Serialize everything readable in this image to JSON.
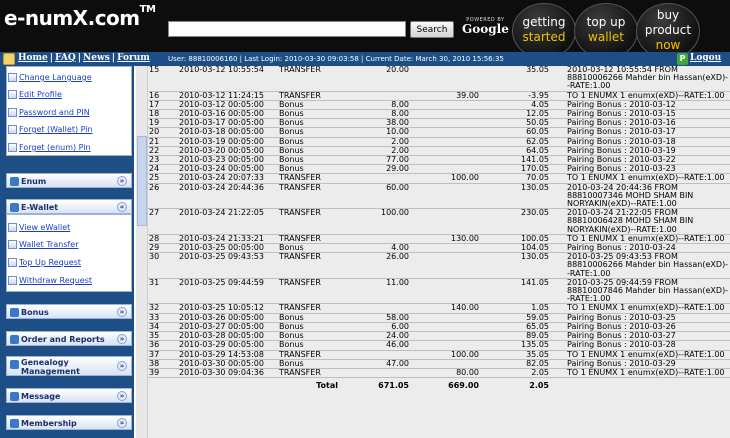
{
  "header": {
    "logo": "e-numX.com",
    "logo_tm": "TM",
    "search_placeholder": "",
    "search_button": "Search",
    "google_powered": "POWERED BY",
    "google_name": "Google",
    "promos": [
      {
        "line1": "getting",
        "line2": "started"
      },
      {
        "line1": "top up",
        "line2": "wallet"
      },
      {
        "line1": "buy",
        "line2": "product",
        "line3": "now"
      }
    ]
  },
  "nav": {
    "home": "Home",
    "faq": "FAQ",
    "news": "News",
    "forum": "Forum",
    "sep": "|",
    "userinfo": "User: 88810006160 | Last Login: 2010-03-30 09:03:58 | Current Date: March 30, 2010 15:56:35",
    "logout": "Logou"
  },
  "sidebar": {
    "account_links": [
      "Change Language",
      "Edit Profile",
      "Password and PIN",
      "Forget (Wallet) Pin",
      "Forget (enum) Pin"
    ],
    "enum": "Enum",
    "ewallet": "E-Wallet",
    "ewallet_links": [
      "View eWallet",
      "Wallet Transfer",
      "Top Up Request",
      "Withdraw Request"
    ],
    "bonus": "Bonus",
    "orders": "Order and Reports",
    "genealogy_1": "Genealogy",
    "genealogy_2": "Management",
    "message": "Message",
    "membership": "Membership"
  },
  "table": {
    "rows": [
      {
        "no": "15",
        "date": "2010-03-12 10:55:54",
        "type": "TRANSFER",
        "debit": "20.00",
        "credit": "",
        "balance": "35.05",
        "desc": "2010-03-12 10:55:54 FROM 88810006266 Mahder bin Hassan(eXD)--RATE:1.00"
      },
      {
        "no": "16",
        "date": "2010-03-12 11:24:15",
        "type": "TRANSFER",
        "debit": "",
        "credit": "39.00",
        "balance": "-3.95",
        "desc": "TO 1 ENUMX 1 enumx(eXD)--RATE:1.00"
      },
      {
        "no": "17",
        "date": "2010-03-12 00:05:00",
        "type": "Bonus",
        "debit": "8.00",
        "credit": "",
        "balance": "4.05",
        "desc": "Pairing Bonus : 2010-03-12"
      },
      {
        "no": "18",
        "date": "2010-03-16 00:05:00",
        "type": "Bonus",
        "debit": "8.00",
        "credit": "",
        "balance": "12.05",
        "desc": "Pairing Bonus : 2010-03-15"
      },
      {
        "no": "19",
        "date": "2010-03-17 00:05:00",
        "type": "Bonus",
        "debit": "38.00",
        "credit": "",
        "balance": "50.05",
        "desc": "Pairing Bonus : 2010-03-16"
      },
      {
        "no": "20",
        "date": "2010-03-18 00:05:00",
        "type": "Bonus",
        "debit": "10.00",
        "credit": "",
        "balance": "60.05",
        "desc": "Pairing Bonus : 2010-03-17"
      },
      {
        "no": "21",
        "date": "2010-03-19 00:05:00",
        "type": "Bonus",
        "debit": "2.00",
        "credit": "",
        "balance": "62.05",
        "desc": "Pairing Bonus : 2010-03-18"
      },
      {
        "no": "22",
        "date": "2010-03-20 00:05:00",
        "type": "Bonus",
        "debit": "2.00",
        "credit": "",
        "balance": "64.05",
        "desc": "Pairing Bonus : 2010-03-19"
      },
      {
        "no": "23",
        "date": "2010-03-23 00:05:00",
        "type": "Bonus",
        "debit": "77.00",
        "credit": "",
        "balance": "141.05",
        "desc": "Pairing Bonus : 2010-03-22"
      },
      {
        "no": "24",
        "date": "2010-03-24 00:05:00",
        "type": "Bonus",
        "debit": "29.00",
        "credit": "",
        "balance": "170.05",
        "desc": "Pairing Bonus : 2010-03-23"
      },
      {
        "no": "25",
        "date": "2010-03-24 20:07:33",
        "type": "TRANSFER",
        "debit": "",
        "credit": "100.00",
        "balance": "70.05",
        "desc": "TO 1 ENUMX 1 enumx(eXD)--RATE:1.00"
      },
      {
        "no": "26",
        "date": "2010-03-24 20:44:36",
        "type": "TRANSFER",
        "debit": "60.00",
        "credit": "",
        "balance": "130.05",
        "desc": "2010-03-24 20:44:36 FROM 88810007346 MOHD SHAM BIN NORYAKIN(eXD)--RATE:1.00"
      },
      {
        "no": "27",
        "date": "2010-03-24 21:22:05",
        "type": "TRANSFER",
        "debit": "100.00",
        "credit": "",
        "balance": "230.05",
        "desc": "2010-03-24 21:22:05 FROM 88810006428 MOHD SHAM BIN NORYAKIN(eXD)--RATE:1.00"
      },
      {
        "no": "28",
        "date": "2010-03-24 21:33:21",
        "type": "TRANSFER",
        "debit": "",
        "credit": "130.00",
        "balance": "100.05",
        "desc": "TO 1 ENUMX 1 enumx(eXD)--RATE:1.00"
      },
      {
        "no": "29",
        "date": "2010-03-25 00:05:00",
        "type": "Bonus",
        "debit": "4.00",
        "credit": "",
        "balance": "104.05",
        "desc": "Pairing Bonus : 2010-03-24"
      },
      {
        "no": "30",
        "date": "2010-03-25 09:43:53",
        "type": "TRANSFER",
        "debit": "26.00",
        "credit": "",
        "balance": "130.05",
        "desc": "2010-03-25 09:43:53 FROM 88810006266 Mahder bin Hassan(eXD)--RATE:1.00"
      },
      {
        "no": "31",
        "date": "2010-03-25 09:44:59",
        "type": "TRANSFER",
        "debit": "11.00",
        "credit": "",
        "balance": "141.05",
        "desc": "2010-03-25 09:44:59 FROM 88810007846 Mahder bin Hassan(eXD)--RATE:1.00"
      },
      {
        "no": "32",
        "date": "2010-03-25 10:05:12",
        "type": "TRANSFER",
        "debit": "",
        "credit": "140.00",
        "balance": "1.05",
        "desc": "TO 1 ENUMX 1 enumx(eXD)--RATE:1.00"
      },
      {
        "no": "33",
        "date": "2010-03-26 00:05:00",
        "type": "Bonus",
        "debit": "58.00",
        "credit": "",
        "balance": "59.05",
        "desc": "Pairing Bonus : 2010-03-25"
      },
      {
        "no": "34",
        "date": "2010-03-27 00:05:00",
        "type": "Bonus",
        "debit": "6.00",
        "credit": "",
        "balance": "65.05",
        "desc": "Pairing Bonus : 2010-03-26"
      },
      {
        "no": "35",
        "date": "2010-03-28 00:05:00",
        "type": "Bonus",
        "debit": "24.00",
        "credit": "",
        "balance": "89.05",
        "desc": "Pairing Bonus : 2010-03-27"
      },
      {
        "no": "36",
        "date": "2010-03-29 00:05:00",
        "type": "Bonus",
        "debit": "46.00",
        "credit": "",
        "balance": "135.05",
        "desc": "Pairing Bonus : 2010-03-28"
      },
      {
        "no": "37",
        "date": "2010-03-29 14:53:08",
        "type": "TRANSFER",
        "debit": "",
        "credit": "100.00",
        "balance": "35.05",
        "desc": "TO 1 ENUMX 1 enumx(eXD)--RATE:1.00"
      },
      {
        "no": "38",
        "date": "2010-03-30 00:05:00",
        "type": "Bonus",
        "debit": "47.00",
        "credit": "",
        "balance": "82.05",
        "desc": "Pairing Bonus : 2010-03-29"
      },
      {
        "no": "39",
        "date": "2010-03-30 09:04:36",
        "type": "TRANSFER",
        "debit": "",
        "credit": "80.00",
        "balance": "2.05",
        "desc": "TO 1 ENUMX 1 enumx(eXD)--RATE:1.00"
      }
    ],
    "total_label": "Total",
    "total_debit": "671.05",
    "total_credit": "669.00",
    "total_balance": "2.05"
  }
}
